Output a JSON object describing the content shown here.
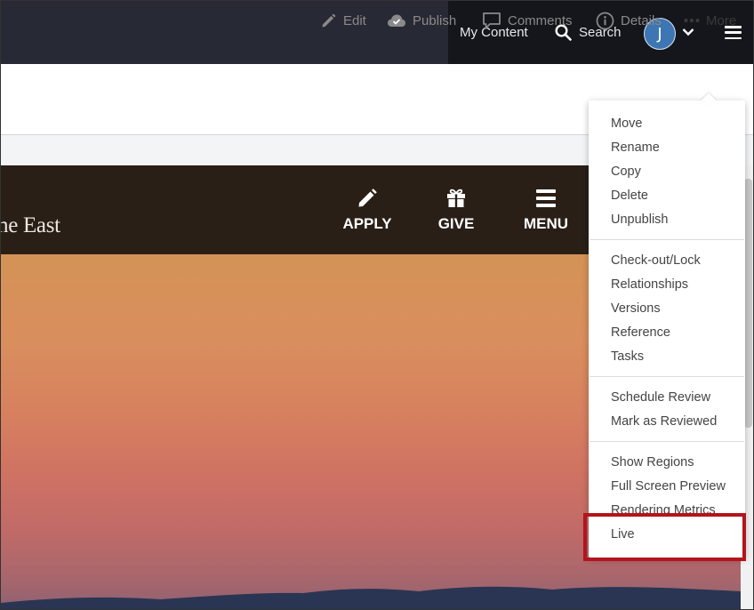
{
  "topnav": {
    "my_content": "My Content",
    "search": "Search",
    "avatar_initial": "J"
  },
  "toolbar": {
    "edit": "Edit",
    "publish": "Publish",
    "comments": "Comments",
    "details": "Details",
    "more": "More"
  },
  "site": {
    "title": "he East",
    "nav": [
      {
        "label": "APPLY",
        "icon": "pencil-icon"
      },
      {
        "label": "GIVE",
        "icon": "gift-icon"
      },
      {
        "label": "MENU",
        "icon": "menu-icon"
      }
    ]
  },
  "more_menu": {
    "groups": [
      [
        "Move",
        "Rename",
        "Copy",
        "Delete",
        "Unpublish"
      ],
      [
        "Check-out/Lock",
        "Relationships",
        "Versions",
        "Reference",
        "Tasks"
      ],
      [
        "Schedule Review",
        "Mark as Reviewed"
      ],
      [
        "Show Regions",
        "Full Screen Preview",
        "Rendering Metrics",
        "Live"
      ]
    ],
    "highlighted_item": "Live",
    "highlight_color": "#b3141c"
  },
  "colors": {
    "topnav_bg": "#272a34",
    "site_header_bg": "#2a1f17",
    "avatar_bg": "#3d76b3"
  }
}
